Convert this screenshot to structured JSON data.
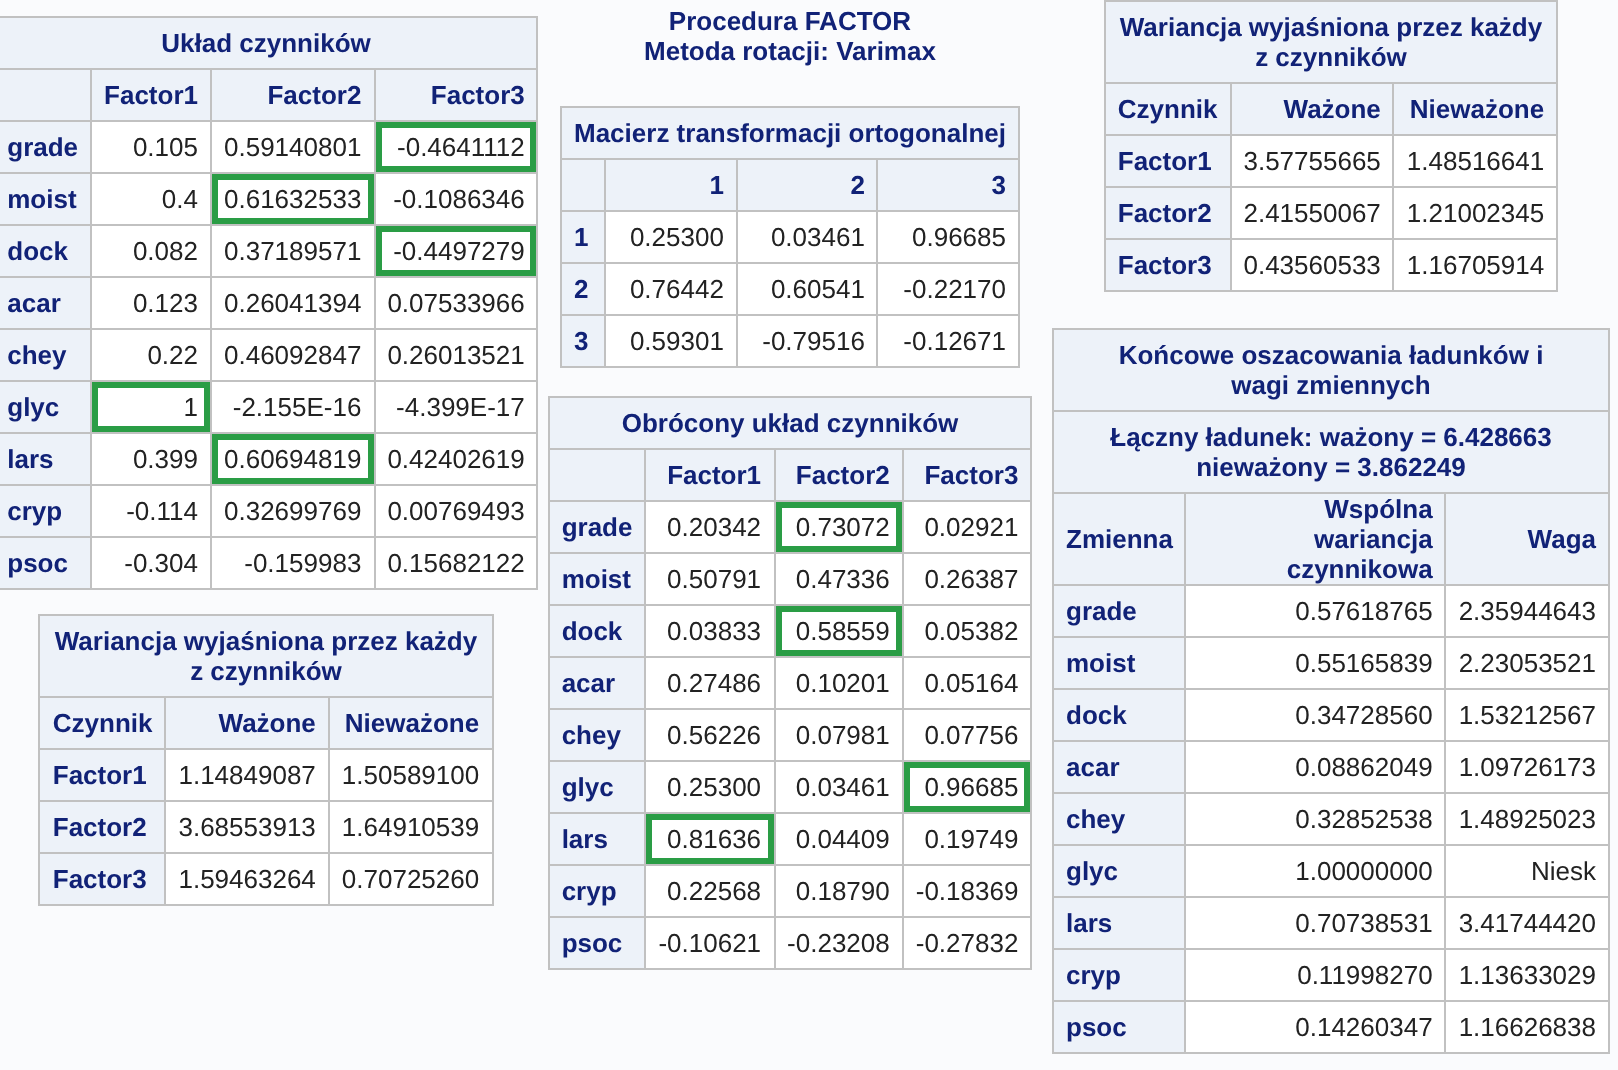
{
  "columns": [
    {
      "items": [
        {
          "kind": "table",
          "title_lines": [
            "Układ czynników"
          ],
          "columns": [
            "Factor1",
            "Factor2",
            "Factor3"
          ],
          "rows": [
            {
              "label": "grade",
              "cells": [
                {
                  "value": "0.105",
                  "highlighted": false
                },
                {
                  "value": "0.59140801",
                  "highlighted": false
                },
                {
                  "value": "-0.4641112",
                  "highlighted": true
                }
              ]
            },
            {
              "label": "moist",
              "cells": [
                {
                  "value": "0.4",
                  "highlighted": false
                },
                {
                  "value": "0.61632533",
                  "highlighted": true
                },
                {
                  "value": "-0.1086346",
                  "highlighted": false
                }
              ]
            },
            {
              "label": "dock",
              "cells": [
                {
                  "value": "0.082",
                  "highlighted": false
                },
                {
                  "value": "0.37189571",
                  "highlighted": false
                },
                {
                  "value": "-0.4497279",
                  "highlighted": true
                }
              ]
            },
            {
              "label": "acar",
              "cells": [
                {
                  "value": "0.123",
                  "highlighted": false
                },
                {
                  "value": "0.26041394",
                  "highlighted": false
                },
                {
                  "value": "0.07533966",
                  "highlighted": false
                }
              ]
            },
            {
              "label": "chey",
              "cells": [
                {
                  "value": "0.22",
                  "highlighted": false
                },
                {
                  "value": "0.46092847",
                  "highlighted": false
                },
                {
                  "value": "0.26013521",
                  "highlighted": false
                }
              ]
            },
            {
              "label": "glyc",
              "cells": [
                {
                  "value": "1",
                  "highlighted": true
                },
                {
                  "value": "-2.155E-16",
                  "highlighted": false
                },
                {
                  "value": "-4.399E-17",
                  "highlighted": false
                }
              ]
            },
            {
              "label": "lars",
              "cells": [
                {
                  "value": "0.399",
                  "highlighted": false
                },
                {
                  "value": "0.60694819",
                  "highlighted": true
                },
                {
                  "value": "0.42402619",
                  "highlighted": false
                }
              ]
            },
            {
              "label": "cryp",
              "cells": [
                {
                  "value": "-0.114",
                  "highlighted": false
                },
                {
                  "value": "0.32699769",
                  "highlighted": false
                },
                {
                  "value": "0.00769493",
                  "highlighted": false
                }
              ]
            },
            {
              "label": "psoc",
              "cells": [
                {
                  "value": "-0.304",
                  "highlighted": false
                },
                {
                  "value": "-0.159983",
                  "highlighted": false
                },
                {
                  "value": "0.15682122",
                  "highlighted": false
                }
              ]
            }
          ]
        },
        {
          "kind": "table",
          "title_lines": [
            "Wariancja wyjaśniona przez każdy",
            "z czynników"
          ],
          "row_heading": "Czynnik",
          "columns": [
            "Ważone",
            "Nieważone"
          ],
          "rows": [
            {
              "label": "Factor1",
              "cells": [
                "1.14849087",
                "1.50589100"
              ]
            },
            {
              "label": "Factor2",
              "cells": [
                "3.68553913",
                "1.64910539"
              ]
            },
            {
              "label": "Factor3",
              "cells": [
                "1.59463264",
                "0.70725260"
              ]
            }
          ]
        }
      ]
    },
    {
      "items": [
        {
          "kind": "heading",
          "lines": [
            "Procedura FACTOR",
            "Metoda rotacji: Varimax"
          ]
        },
        {
          "kind": "table",
          "title_lines": [
            "Macierz transformacji ortogonalnej"
          ],
          "columns": [
            "1",
            "2",
            "3"
          ],
          "rows": [
            {
              "label": "1",
              "cells": [
                "0.25300",
                "0.03461",
                "0.96685"
              ]
            },
            {
              "label": "2",
              "cells": [
                "0.76442",
                "0.60541",
                "-0.22170"
              ]
            },
            {
              "label": "3",
              "cells": [
                "0.59301",
                "-0.79516",
                "-0.12671"
              ]
            }
          ]
        },
        {
          "kind": "table",
          "title_lines": [
            "Obrócony układ czynników"
          ],
          "columns": [
            "Factor1",
            "Factor2",
            "Factor3"
          ],
          "rows": [
            {
              "label": "grade",
              "cells": [
                {
                  "value": "0.20342",
                  "highlighted": false
                },
                {
                  "value": "0.73072",
                  "highlighted": true
                },
                {
                  "value": "0.02921",
                  "highlighted": false
                }
              ]
            },
            {
              "label": "moist",
              "cells": [
                {
                  "value": "0.50791",
                  "highlighted": false
                },
                {
                  "value": "0.47336",
                  "highlighted": false
                },
                {
                  "value": "0.26387",
                  "highlighted": false
                }
              ]
            },
            {
              "label": "dock",
              "cells": [
                {
                  "value": "0.03833",
                  "highlighted": false
                },
                {
                  "value": "0.58559",
                  "highlighted": true
                },
                {
                  "value": "0.05382",
                  "highlighted": false
                }
              ]
            },
            {
              "label": "acar",
              "cells": [
                {
                  "value": "0.27486",
                  "highlighted": false
                },
                {
                  "value": "0.10201",
                  "highlighted": false
                },
                {
                  "value": "0.05164",
                  "highlighted": false
                }
              ]
            },
            {
              "label": "chey",
              "cells": [
                {
                  "value": "0.56226",
                  "highlighted": false
                },
                {
                  "value": "0.07981",
                  "highlighted": false
                },
                {
                  "value": "0.07756",
                  "highlighted": false
                }
              ]
            },
            {
              "label": "glyc",
              "cells": [
                {
                  "value": "0.25300",
                  "highlighted": false
                },
                {
                  "value": "0.03461",
                  "highlighted": false
                },
                {
                  "value": "0.96685",
                  "highlighted": true
                }
              ]
            },
            {
              "label": "lars",
              "cells": [
                {
                  "value": "0.81636",
                  "highlighted": true
                },
                {
                  "value": "0.04409",
                  "highlighted": false
                },
                {
                  "value": "0.19749",
                  "highlighted": false
                }
              ]
            },
            {
              "label": "cryp",
              "cells": [
                {
                  "value": "0.22568",
                  "highlighted": false
                },
                {
                  "value": "0.18790",
                  "highlighted": false
                },
                {
                  "value": "-0.18369",
                  "highlighted": false
                }
              ]
            },
            {
              "label": "psoc",
              "cells": [
                {
                  "value": "-0.10621",
                  "highlighted": false
                },
                {
                  "value": "-0.23208",
                  "highlighted": false
                },
                {
                  "value": "-0.27832",
                  "highlighted": false
                }
              ]
            }
          ]
        }
      ]
    },
    {
      "items": [
        {
          "kind": "table",
          "title_lines": [
            "Wariancja wyjaśniona przez każdy",
            "z czynników"
          ],
          "row_heading": "Czynnik",
          "columns": [
            "Ważone",
            "Nieważone"
          ],
          "rows": [
            {
              "label": "Factor1",
              "cells": [
                "3.57755665",
                "1.48516641"
              ]
            },
            {
              "label": "Factor2",
              "cells": [
                "2.41550067",
                "1.21002345"
              ]
            },
            {
              "label": "Factor3",
              "cells": [
                "0.43560533",
                "1.16705914"
              ]
            }
          ]
        },
        {
          "kind": "table",
          "title_lines": [
            "Końcowe oszacowania ładunków i",
            "wagi zmiennych"
          ],
          "subtitle_lines": [
            "Łączny ładunek: ważony = 6.428663",
            "nieważony = 3.862249"
          ],
          "row_heading": "Zmienna",
          "columns": [
            "Wspólna wariancja czynnikowa",
            "Waga"
          ],
          "rows": [
            {
              "label": "grade",
              "cells": [
                "0.57618765",
                "2.35944643"
              ]
            },
            {
              "label": "moist",
              "cells": [
                "0.55165839",
                "2.23053521"
              ]
            },
            {
              "label": "dock",
              "cells": [
                "0.34728560",
                "1.53212567"
              ]
            },
            {
              "label": "acar",
              "cells": [
                "0.08862049",
                "1.09726173"
              ]
            },
            {
              "label": "chey",
              "cells": [
                "0.32852538",
                "1.48925023"
              ]
            },
            {
              "label": "glyc",
              "cells": [
                "1.00000000",
                "Niesk"
              ]
            },
            {
              "label": "lars",
              "cells": [
                "0.70738531",
                "3.41744420"
              ]
            },
            {
              "label": "cryp",
              "cells": [
                "0.11998270",
                "1.13633029"
              ]
            },
            {
              "label": "psoc",
              "cells": [
                "0.14260347",
                "1.16626838"
              ]
            }
          ]
        }
      ]
    }
  ]
}
